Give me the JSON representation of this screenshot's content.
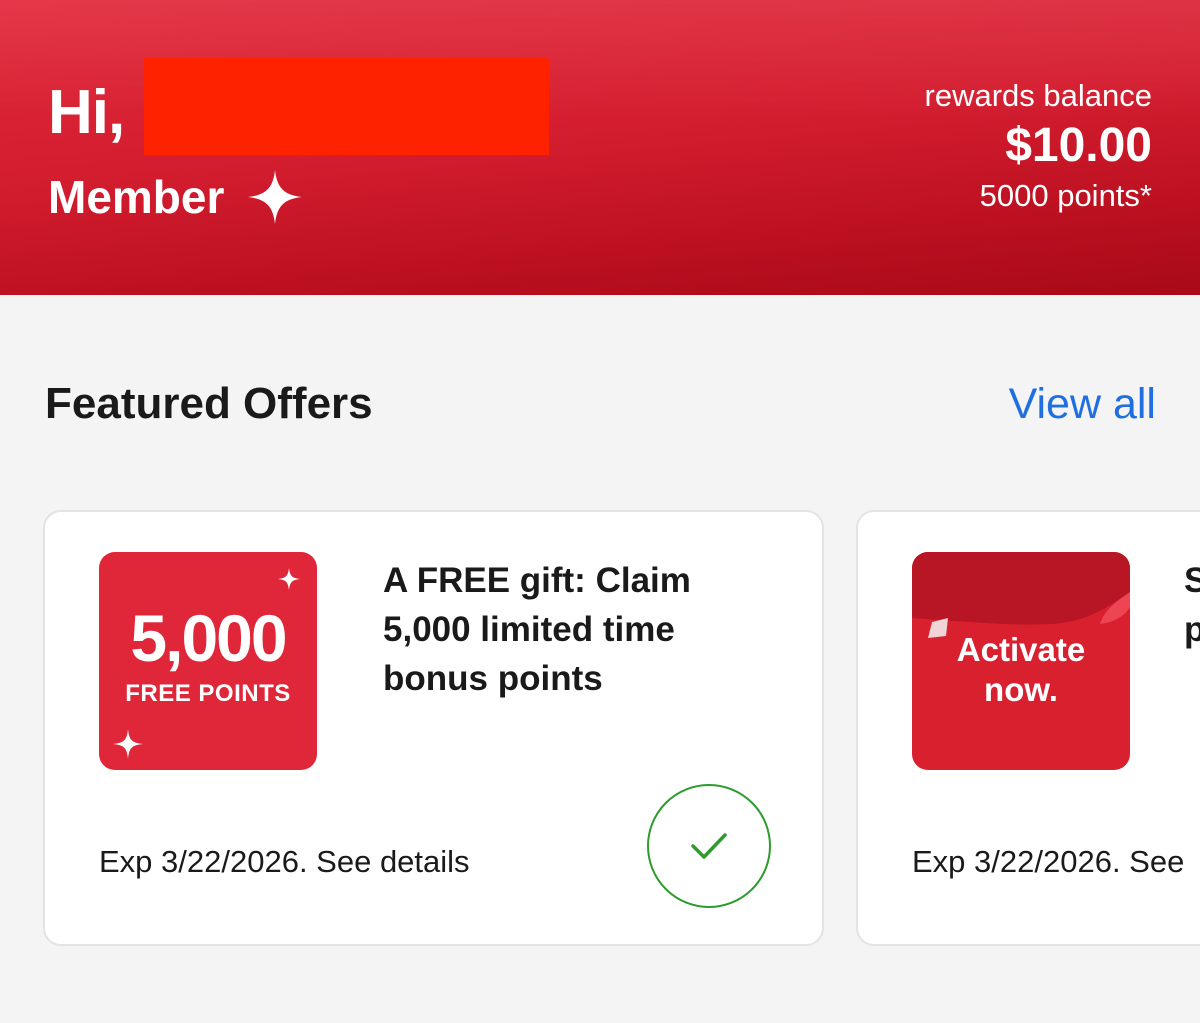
{
  "header": {
    "greeting": "Hi,",
    "tier_label": "Member",
    "tier_icon": "sparkle-icon",
    "balance_caption": "rewards balance",
    "balance_amount": "$10.00",
    "balance_points": "5000 points*",
    "colors": {
      "brand_red": "#d41e30",
      "redaction": "#ff2200"
    }
  },
  "featured": {
    "title": "Featured Offers",
    "view_all": "View all",
    "link_color": "#1f6fe0"
  },
  "offers": [
    {
      "image_big": "5,000",
      "image_small": "FREE POINTS",
      "title": "A FREE gift: Claim 5,000 limited time bonus points",
      "expiry": "Exp 3/22/2026. See details",
      "status_icon": "checkmark-icon",
      "status": "activated",
      "status_color": "#2e9b2e"
    },
    {
      "image_text_line1": "Activate",
      "image_text_line2": "now.",
      "title_line1": "S",
      "title_line2": "p",
      "expiry": "Exp 3/22/2026. See"
    }
  ]
}
